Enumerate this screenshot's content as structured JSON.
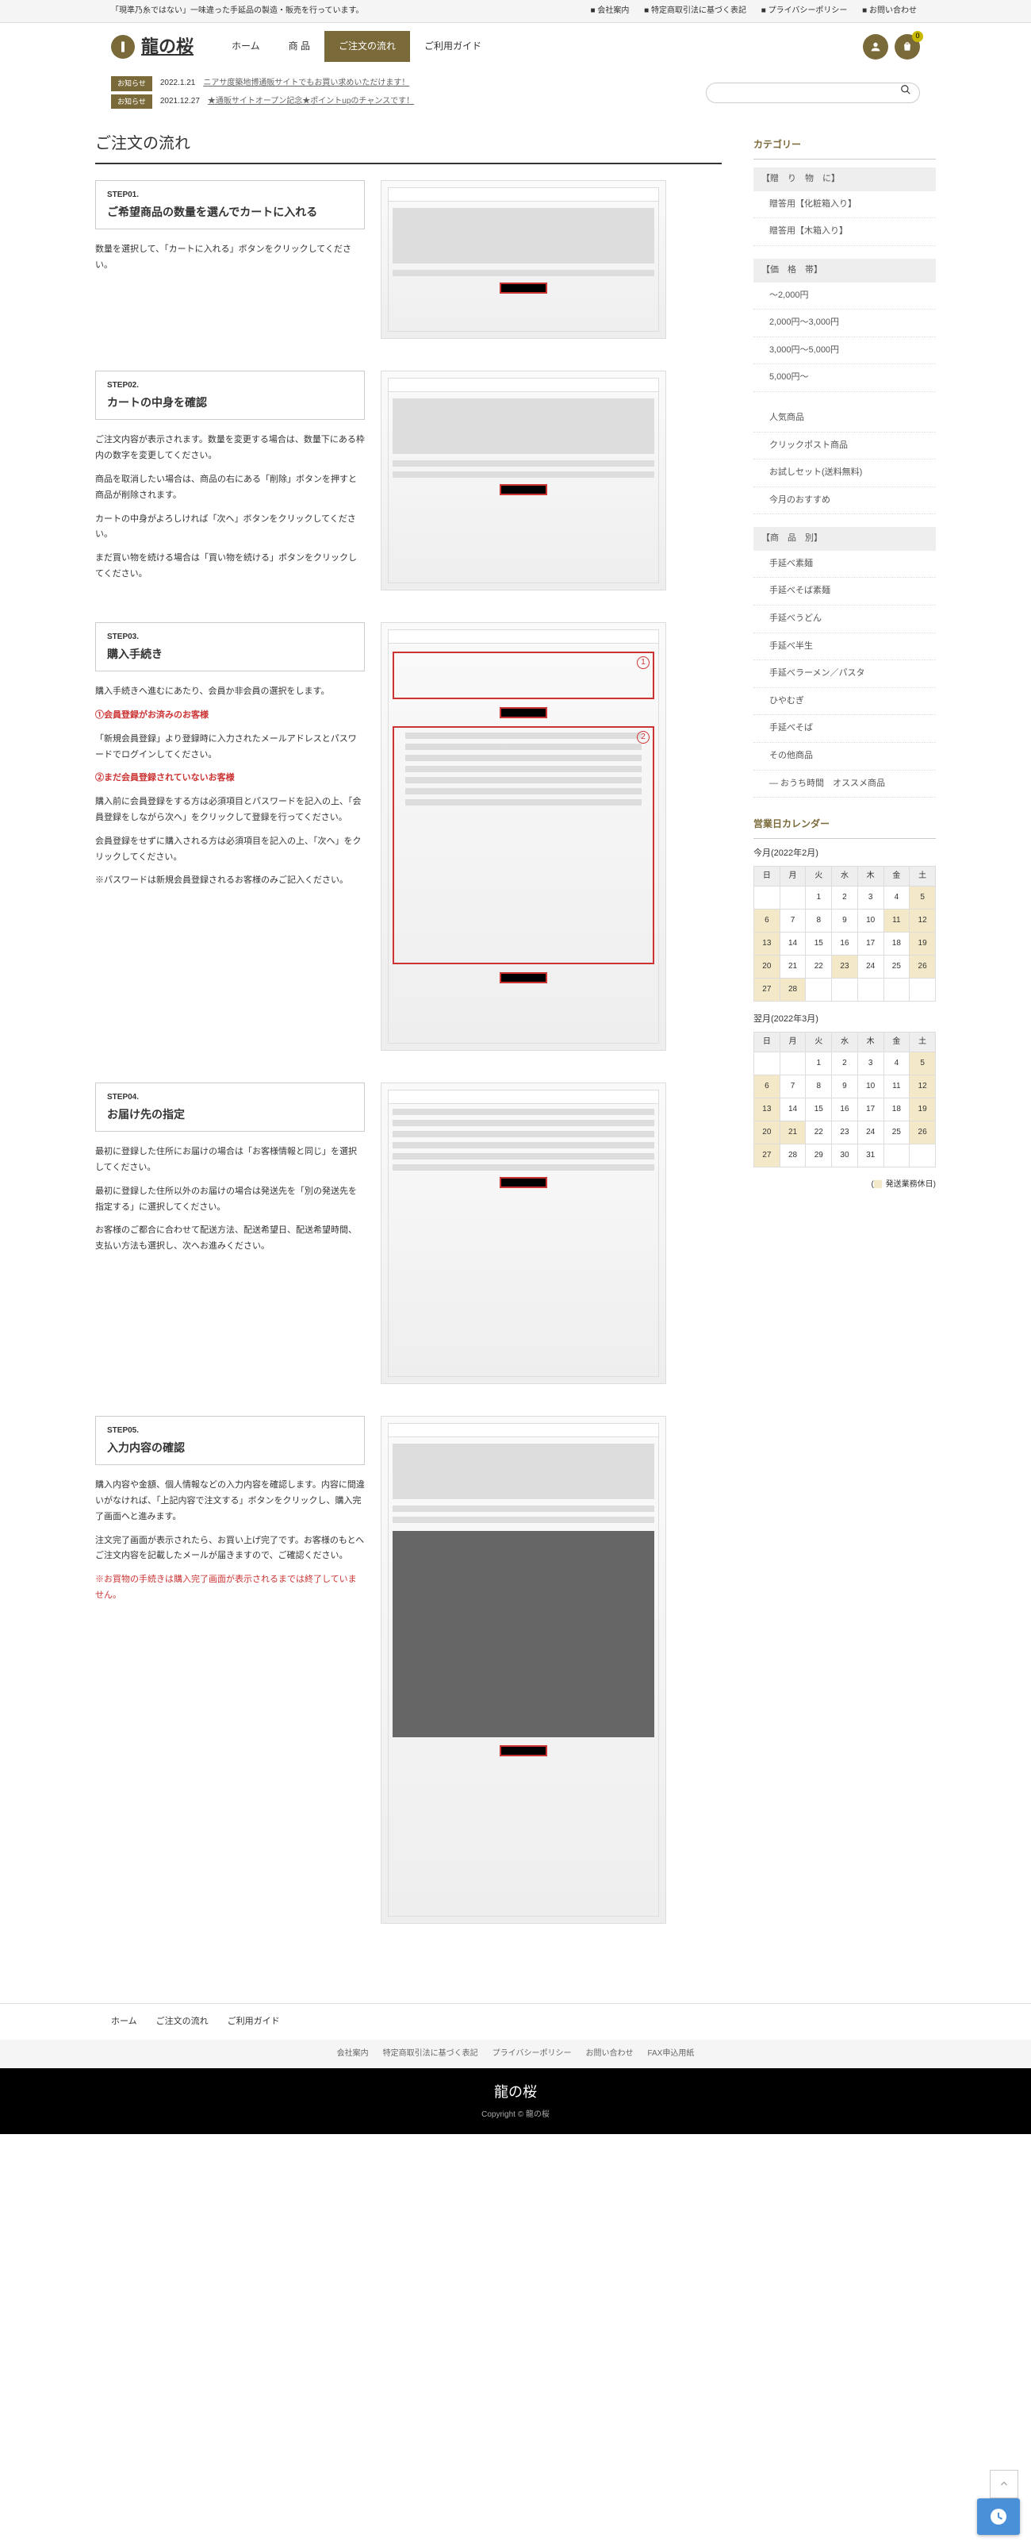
{
  "topbar": {
    "tagline": "「現準乃糸ではない」一味違った手延品の製造・販売を行っています。",
    "links": [
      "■ 会社案内",
      "■ 特定商取引法に基づく表記",
      "■ プライバシーポリシー",
      "■ お問い合わせ"
    ]
  },
  "brand": "龍の桜",
  "nav": [
    {
      "label": "ホーム",
      "active": false
    },
    {
      "label": "商 品",
      "active": false
    },
    {
      "label": "ご注文の流れ",
      "active": true
    },
    {
      "label": "ご利用ガイド",
      "active": false
    }
  ],
  "cart_count": "0",
  "news": [
    {
      "label": "お知らせ",
      "date": "2022.1.21",
      "text": "ニアサ度築地博通販サイトでもお買い求めいただけます！"
    },
    {
      "label": "お知らせ",
      "date": "2021.12.27",
      "text": "★通販サイトオープン記念★ポイントupのチャンスです！"
    }
  ],
  "search_placeholder": "",
  "page_title": "ご注文の流れ",
  "steps": [
    {
      "num": "STEP01.",
      "title": "ご希望商品の数量を選んでカートに入れる",
      "paras": [
        "数量を選択して、「カートに入れる」ボタンをクリックしてください。"
      ]
    },
    {
      "num": "STEP02.",
      "title": "カートの中身を確認",
      "paras": [
        "ご注文内容が表示されます。数量を変更する場合は、数量下にある枠内の数字を変更してください。",
        "商品を取消したい場合は、商品の右にある「削除」ボタンを押すと商品が削除されます。",
        "カートの中身がよろしければ「次へ」ボタンをクリックしてください。",
        "まだ買い物を続ける場合は「買い物を続ける」ボタンをクリックしてください。"
      ]
    },
    {
      "num": "STEP03.",
      "title": "購入手続き",
      "paras": [
        "購入手続きへ進むにあたり、会員か非会員の選択をします。"
      ],
      "h1": "①会員登録がお済みのお客様",
      "p1": [
        "「新規会員登録」より登録時に入力されたメールアドレスとパスワードでログインしてください。"
      ],
      "h2": "②まだ会員登録されていないお客様",
      "p2": [
        "購入前に会員登録をする方は必須項目とパスワードを記入の上、「会員登録をしながら次へ」をクリックして登録を行ってください。",
        "会員登録をせずに購入される方は必須項目を記入の上、「次へ」をクリックしてください。",
        "※パスワードは新規会員登録されるお客様のみご記入ください。"
      ]
    },
    {
      "num": "STEP04.",
      "title": "お届け先の指定",
      "paras": [
        "最初に登録した住所にお届けの場合は「お客様情報と同じ」を選択してください。",
        "最初に登録した住所以外のお届けの場合は発送先を「別の発送先を指定する」に選択してください。",
        "お客様のご都合に合わせて配送方法、配送希望日、配送希望時間、支払い方法も選択し、次へお進みください。"
      ]
    },
    {
      "num": "STEP05.",
      "title": "入力内容の確認",
      "paras": [
        "購入内容や金額、個人情報などの入力内容を確認します。内容に間違いがなければ、「上記内容で注文する」ボタンをクリックし、購入完了画面へと進みます。",
        "注文完了画面が表示されたら、お買い上げ完了です。お客様のもとへご注文内容を記載したメールが届きますので、ご確認ください。"
      ],
      "warn": "※お買物の手続きは購入完了画面が表示されるまでは終了していません。"
    }
  ],
  "sidebar": {
    "cat_title": "カテゴリー",
    "groups": [
      {
        "header": "【贈　り　物　に】",
        "items": [
          "贈答用【化粧箱入り】",
          "贈答用【木箱入り】"
        ]
      },
      {
        "header": "【価　格　帯】",
        "items": [
          "〜2,000円",
          "2,000円〜3,000円",
          "3,000円〜5,000円",
          "5,000円〜"
        ]
      },
      {
        "header": "",
        "items": [
          "人気商品",
          "クリックポスト商品",
          "お試しセット(送料無料)",
          "今月のおすすめ"
        ]
      },
      {
        "header": "【商　品　別】",
        "items": [
          "手延べ素麺",
          "手延べそば素麺",
          "手延べうどん",
          "手延べ半生",
          "手延べラーメン／パスタ",
          "ひやむぎ",
          "手延べそば",
          "その他商品",
          "— おうち時間　オススメ商品"
        ]
      }
    ],
    "cal_title": "営業日カレンダー",
    "month1_title": "今月(2022年2月)",
    "month2_title": "翌月(2022年3月)",
    "dow": [
      "日",
      "月",
      "火",
      "水",
      "木",
      "金",
      "土"
    ],
    "legend": "発送業務休日"
  },
  "footer_nav": [
    "ホーム",
    "ご注文の流れ",
    "ご利用ガイド"
  ],
  "footer_sub": [
    "会社案内",
    "特定商取引法に基づく表記",
    "プライバシーポリシー",
    "お問い合わせ",
    "FAX申込用紙"
  ],
  "footer_brand": "龍の桜",
  "copyright": "Copyright © 龍の桜"
}
